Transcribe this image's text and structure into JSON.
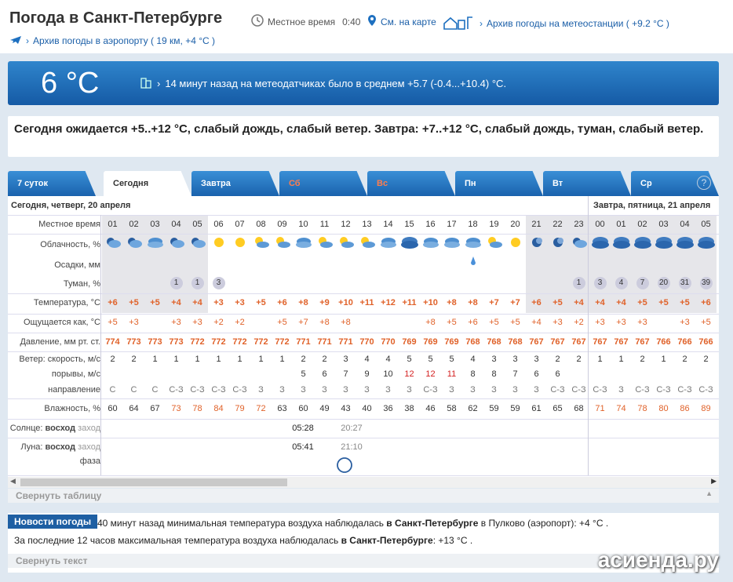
{
  "header": {
    "title": "Погода в Санкт-Петербурге",
    "local_time_label": "Местное время",
    "local_time": "0:40",
    "map_link": "См. на карте",
    "station_link": "Архив погоды на метеостанции ( +9.2 °C )",
    "airport_link": "Архив погоды в аэропорту ( 19 км, +4 °C )"
  },
  "now": {
    "temp": "6 °C",
    "sensors": "14 минут назад на метеодатчиках было в среднем +5.7 (-0.4...+10.4) °C."
  },
  "summary": "Сегодня ожидается +5..+12 °C, слабый дождь, слабый ветер. Завтра: +7..+12 °C, слабый дождь, туман, слабый ветер.",
  "tabs": [
    {
      "label": "7 суток"
    },
    {
      "label": "Сегодня"
    },
    {
      "label": "Завтра"
    },
    {
      "label": "Сб"
    },
    {
      "label": "Вс"
    },
    {
      "label": "Пн"
    },
    {
      "label": "Вт"
    },
    {
      "label": "Ср"
    }
  ],
  "day_today": "Сегодня, четверг, 20 апреля",
  "day_tomorrow": "Завтра, пятница, 21 апреля",
  "labels": {
    "time": "Местное время",
    "cloud": "Облачность, %",
    "precip": "Осадки, мм",
    "fog": "Туман, %",
    "temp": "Температура, °C",
    "feels": "Ощущается как, °C",
    "press": "Давление, мм рт. ст.",
    "wind": "Ветер: скорость, м/с",
    "gust": "порывы, м/с",
    "dir": "направление",
    "hum": "Влажность, %",
    "sun": "Солнце:",
    "sun_rise": "восход",
    "sun_set": "заход",
    "moon": "Луна:",
    "moon_rise": "восход",
    "moon_set": "заход",
    "phase": "фаза"
  },
  "hours": [
    "01",
    "02",
    "03",
    "04",
    "05",
    "06",
    "07",
    "08",
    "09",
    "10",
    "11",
    "12",
    "13",
    "14",
    "15",
    "16",
    "17",
    "18",
    "19",
    "20",
    "21",
    "22",
    "23",
    "00",
    "01",
    "02",
    "03",
    "04",
    "05"
  ],
  "fog": [
    "",
    "",
    "",
    "1",
    "1",
    "3",
    "",
    "",
    "",
    "",
    "",
    "",
    "",
    "",
    "",
    "",
    "",
    "",
    "",
    "",
    "",
    "",
    "1",
    "3",
    "4",
    "7",
    "20",
    "31",
    "39"
  ],
  "temp": [
    "+6",
    "+5",
    "+5",
    "+4",
    "+4",
    "+3",
    "+3",
    "+5",
    "+6",
    "+8",
    "+9",
    "+10",
    "+11",
    "+12",
    "+11",
    "+10",
    "+8",
    "+8",
    "+7",
    "+7",
    "+6",
    "+5",
    "+4",
    "+4",
    "+4",
    "+5",
    "+5",
    "+5",
    "+6"
  ],
  "feels": [
    "+5",
    "+3",
    "",
    "+3",
    "+3",
    "+2",
    "+2",
    "",
    "+5",
    "+7",
    "+8",
    "+8",
    "",
    "",
    "",
    "+8",
    "+5",
    "+6",
    "+5",
    "+5",
    "+4",
    "+3",
    "+2",
    "+3",
    "+3",
    "+3",
    "",
    "+3",
    "+5"
  ],
  "press": [
    "774",
    "773",
    "773",
    "773",
    "772",
    "772",
    "772",
    "772",
    "772",
    "771",
    "771",
    "771",
    "770",
    "770",
    "769",
    "769",
    "769",
    "768",
    "768",
    "768",
    "767",
    "767",
    "767",
    "767",
    "767",
    "767",
    "766",
    "766",
    "766"
  ],
  "wind": [
    "2",
    "2",
    "1",
    "1",
    "1",
    "1",
    "1",
    "1",
    "1",
    "2",
    "2",
    "3",
    "4",
    "4",
    "5",
    "5",
    "5",
    "4",
    "3",
    "3",
    "3",
    "2",
    "2",
    "1",
    "1",
    "2",
    "1",
    "2",
    "2"
  ],
  "gust": [
    "",
    "",
    "",
    "",
    "",
    "",
    "",
    "",
    "",
    "5",
    "6",
    "7",
    "9",
    "10",
    "12",
    "12",
    "11",
    "8",
    "8",
    "7",
    "6",
    "6",
    "",
    "",
    "",
    "",
    "",
    "",
    ""
  ],
  "dir": [
    "С",
    "С",
    "С",
    "С-З",
    "С-З",
    "С-З",
    "С-З",
    "З",
    "З",
    "З",
    "З",
    "З",
    "З",
    "З",
    "З",
    "С-З",
    "З",
    "З",
    "З",
    "З",
    "З",
    "С-З",
    "С-З",
    "С-З",
    "З",
    "С-З",
    "С-З",
    "С-З",
    "С-З"
  ],
  "hum": [
    "60",
    "64",
    "67",
    "73",
    "78",
    "84",
    "79",
    "72",
    "63",
    "60",
    "49",
    "43",
    "40",
    "36",
    "38",
    "46",
    "58",
    "62",
    "59",
    "59",
    "61",
    "65",
    "68",
    "71",
    "74",
    "78",
    "80",
    "86",
    "89"
  ],
  "sun": {
    "rise": "05:28",
    "set": "20:27"
  },
  "moon": {
    "rise": "05:41",
    "set": "21:10"
  },
  "collapse_table": "Свернуть таблицу",
  "news": {
    "tab": "Новости погоды",
    "line1_a": "40 минут назад минимальная температура воздуха наблюдалась",
    "line1_b": "в Санкт-Петербурге",
    "line1_c": "в Пулково (аэропорт): +4 °С .",
    "line2_a": "За последние 12 часов максимальная температура воздуха наблюдалась",
    "line2_b": "в Санкт-Петербурге",
    "line2_c": ": +13 °С ."
  },
  "collapse_text": "Свернуть текст",
  "watermark": "асиенда.ру",
  "colors": {
    "accent": "#1e5fa3",
    "warm": "#e0622a",
    "hot": "#d42020"
  }
}
